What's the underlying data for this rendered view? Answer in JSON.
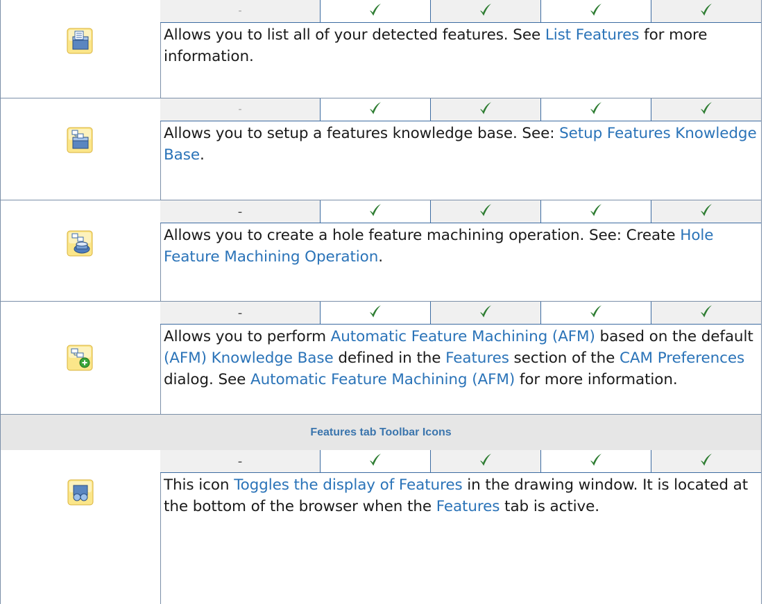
{
  "rows": [
    {
      "icon": "list-features-icon",
      "cells": [
        {
          "text": "-",
          "faint": true
        },
        {
          "check": true
        },
        {
          "check": true
        },
        {
          "check": true
        },
        {
          "check": true
        }
      ],
      "desc": [
        {
          "t": "Allows you to list all of your detected features.  See "
        },
        {
          "t": "List Features",
          "link": true
        },
        {
          "t": " for more information."
        }
      ]
    },
    {
      "icon": "setup-features-knowledge-base-icon",
      "cells": [
        {
          "text": "-",
          "faint": true
        },
        {
          "check": true
        },
        {
          "check": true
        },
        {
          "check": true
        },
        {
          "check": true
        }
      ],
      "desc": [
        {
          "t": "Allows you to setup a features knowledge base.  See: "
        },
        {
          "t": "Setup Features Knowledge Base",
          "link": true
        },
        {
          "t": "."
        }
      ]
    },
    {
      "icon": "hole-feature-machining-icon",
      "cells": [
        {
          "text": "-"
        },
        {
          "check": true
        },
        {
          "check": true
        },
        {
          "check": true
        },
        {
          "check": true
        }
      ],
      "desc": [
        {
          "t": "Allows you to create a hole feature machining operation.  See: Create "
        },
        {
          "t": "Hole Feature Machining Operation",
          "link": true
        },
        {
          "t": "."
        }
      ]
    },
    {
      "icon": "automatic-feature-machining-icon",
      "cells": [
        {
          "text": "-"
        },
        {
          "check": true
        },
        {
          "check": true
        },
        {
          "check": true
        },
        {
          "check": true
        }
      ],
      "desc": [
        {
          "t": "Allows you to perform "
        },
        {
          "t": "Automatic Feature Machining (AFM)",
          "link": true
        },
        {
          "t": " based on the default "
        },
        {
          "t": "(AFM) Knowledge Base",
          "link": true
        },
        {
          "t": " defined in the "
        },
        {
          "t": "Features",
          "link": true
        },
        {
          "t": " section of the "
        },
        {
          "t": "CAM Preferences",
          "link": true
        },
        {
          "t": " dialog.  See "
        },
        {
          "t": "Automatic Feature Machining (AFM)",
          "link": true
        },
        {
          "t": " for more information."
        }
      ]
    }
  ],
  "section_header": "Features tab Toolbar Icons",
  "last_row": {
    "icon": "toggle-features-display-icon",
    "cells": [
      {
        "text": "-"
      },
      {
        "check": true
      },
      {
        "check": true
      },
      {
        "check": true
      },
      {
        "check": true
      }
    ],
    "desc": [
      {
        "t": "This icon "
      },
      {
        "t": "Toggles the display of Features",
        "link": true
      },
      {
        "t": " in the drawing window.  It is located at the bottom of the browser when the "
      },
      {
        "t": "Features",
        "link": true
      },
      {
        "t": " tab is active."
      }
    ]
  },
  "colors": {
    "link": "#2a73b8",
    "check": "#2e7d32",
    "border": "#3b6aa0",
    "section_bg": "#e6e6e6"
  }
}
